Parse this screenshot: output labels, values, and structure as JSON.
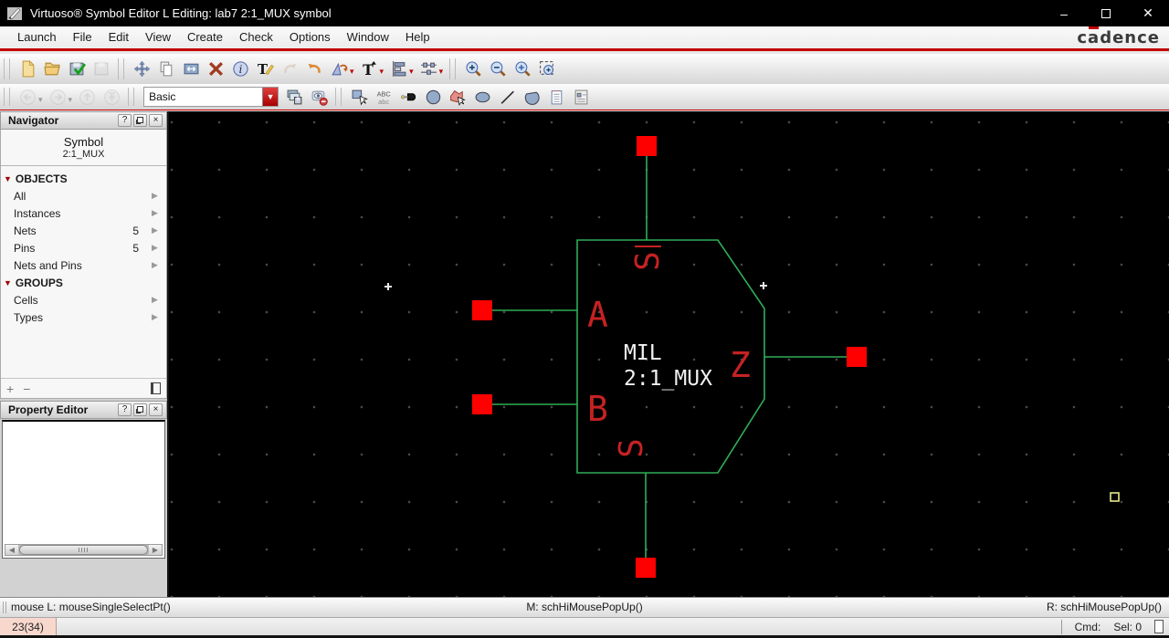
{
  "window": {
    "title": "Virtuoso® Symbol Editor L Editing: lab7 2:1_MUX symbol",
    "minimize": "–",
    "close": "✕"
  },
  "brand": {
    "first": "c",
    "a": "a",
    "rest": "dence"
  },
  "menu": {
    "items": [
      "Launch",
      "File",
      "Edit",
      "View",
      "Create",
      "Check",
      "Options",
      "Window",
      "Help"
    ]
  },
  "toolbar_row1": {
    "groups": [
      {
        "items": [
          {
            "name": "new-file"
          },
          {
            "name": "open"
          },
          {
            "name": "check-save"
          },
          {
            "name": "save",
            "disabled": true
          }
        ]
      },
      {
        "items": [
          {
            "name": "move"
          },
          {
            "name": "copy"
          },
          {
            "name": "stretch"
          },
          {
            "name": "delete"
          },
          {
            "name": "properties"
          },
          {
            "name": "edit-label"
          },
          {
            "name": "undo",
            "disabled": true
          },
          {
            "name": "redo"
          },
          {
            "name": "rotate",
            "caret": true
          },
          {
            "name": "text-options",
            "caret": true
          },
          {
            "name": "align",
            "caret": true
          },
          {
            "name": "distribute",
            "caret": true
          }
        ]
      },
      {
        "items": [
          {
            "name": "zoom-in"
          },
          {
            "name": "zoom-out"
          },
          {
            "name": "zoom-selected"
          },
          {
            "name": "zoom-fit"
          }
        ]
      }
    ]
  },
  "toolbar_row2": {
    "combo_value": "Basic",
    "groups": [
      {
        "items": [
          {
            "name": "back",
            "disabled": true,
            "caret": true,
            "caret_gray": true
          },
          {
            "name": "forward",
            "disabled": true,
            "caret": true,
            "caret_gray": true
          },
          {
            "name": "up",
            "disabled": true
          },
          {
            "name": "top",
            "disabled": true
          }
        ]
      },
      {
        "items": [
          {
            "name": "style-combo",
            "type": "combo"
          },
          {
            "name": "stack-save"
          },
          {
            "name": "eye-remove"
          }
        ]
      },
      {
        "items": [
          {
            "name": "select-tool"
          },
          {
            "name": "label-tool"
          },
          {
            "name": "pin-tool"
          },
          {
            "name": "circle-tool"
          },
          {
            "name": "polygon-tool"
          },
          {
            "name": "ellipse-tool"
          },
          {
            "name": "line-tool"
          },
          {
            "name": "arc-tool"
          },
          {
            "name": "note-tool"
          },
          {
            "name": "doc-tool"
          }
        ]
      }
    ]
  },
  "navigator": {
    "title": "Navigator",
    "help_btn": "?",
    "close_btn": "×",
    "header_view": "Symbol",
    "header_cell": "2:1_MUX",
    "sections": [
      {
        "label": "OBJECTS",
        "items": [
          {
            "label": "All",
            "count": ""
          },
          {
            "label": "Instances",
            "count": ""
          },
          {
            "label": "Nets",
            "count": "5"
          },
          {
            "label": "Pins",
            "count": "5"
          },
          {
            "label": "Nets and Pins",
            "count": ""
          }
        ]
      },
      {
        "label": "GROUPS",
        "items": [
          {
            "label": "Cells",
            "count": ""
          },
          {
            "label": "Types",
            "count": ""
          }
        ]
      }
    ],
    "footer": {
      "add": "+",
      "remove": "−"
    }
  },
  "property_editor": {
    "title": "Property Editor",
    "help_btn": "?",
    "close_btn": "×"
  },
  "canvas": {
    "labels": {
      "pin_a": "A",
      "pin_b": "B",
      "pin_z": "Z",
      "pin_s0_bar": "S",
      "pin_s": "S",
      "cell_line1": "MIL",
      "cell_line2": "2:1_MUX"
    },
    "colors": {
      "wire_green": "#2fae57",
      "pin_red": "#ff0000",
      "label_red": "#c52222",
      "text_white": "#f2f2f2",
      "marker_yellow": "#e9e98a"
    }
  },
  "status_bar": {
    "left": "mouse L: mouseSingleSelectPt()",
    "middle": "M: schHiMousePopUp()",
    "right": "R: schHiMousePopUp()"
  },
  "bottom_bar": {
    "workspace": "23(34)",
    "cmd_label": "Cmd:",
    "sel_label": "Sel: 0"
  }
}
